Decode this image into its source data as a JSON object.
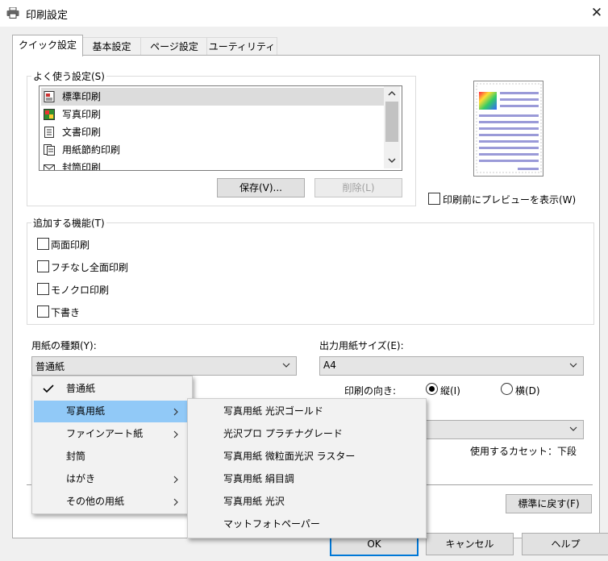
{
  "window": {
    "title": "印刷設定",
    "close_glyph": "✕"
  },
  "tabs": [
    {
      "label": "クイック設定",
      "active": true
    },
    {
      "label": "基本設定",
      "active": false
    },
    {
      "label": "ページ設定",
      "active": false
    },
    {
      "label": "ユーティリティ",
      "active": false
    }
  ],
  "frequent": {
    "legend": "よく使う設定(S)",
    "items": [
      {
        "label": "標準印刷",
        "icon": "standard-print-icon",
        "selected": true
      },
      {
        "label": "写真印刷",
        "icon": "photo-print-icon",
        "selected": false
      },
      {
        "label": "文書印刷",
        "icon": "document-print-icon",
        "selected": false
      },
      {
        "label": "用紙節約印刷",
        "icon": "paper-saving-print-icon",
        "selected": false
      },
      {
        "label": "封筒印刷",
        "icon": "envelope-print-icon",
        "selected": false
      }
    ],
    "save_label": "保存(V)...",
    "delete_label": "削除(L)"
  },
  "preview_checkbox_label": "印刷前にプレビューを表示(W)",
  "features": {
    "legend": "追加する機能(T)",
    "options": [
      {
        "label": "両面印刷",
        "checked": false
      },
      {
        "label": "フチなし全面印刷",
        "checked": false
      },
      {
        "label": "モノクロ印刷",
        "checked": false
      },
      {
        "label": "下書き",
        "checked": false
      }
    ]
  },
  "media_type": {
    "label": "用紙の種類(Y):",
    "value": "普通紙"
  },
  "output_size": {
    "label": "出力用紙サイズ(E):",
    "value": "A4"
  },
  "orientation": {
    "label": "印刷の向き:",
    "portrait": "縦(I)",
    "landscape": "横(D)",
    "selected": "portrait"
  },
  "cassette_text": "使用するカセット：下段",
  "defaults_label": "標準に戻す(F)",
  "footer": {
    "ok": "OK",
    "cancel": "キャンセル",
    "help": "ヘルプ"
  },
  "media_menu": {
    "items": [
      {
        "label": "普通紙",
        "checked": true,
        "submenu": false,
        "highlight": false
      },
      {
        "label": "写真用紙",
        "checked": false,
        "submenu": true,
        "highlight": true
      },
      {
        "label": "ファインアート紙",
        "checked": false,
        "submenu": true,
        "highlight": false
      },
      {
        "label": "封筒",
        "checked": false,
        "submenu": false,
        "highlight": false
      },
      {
        "label": "はがき",
        "checked": false,
        "submenu": true,
        "highlight": false
      },
      {
        "label": "その他の用紙",
        "checked": false,
        "submenu": true,
        "highlight": false
      }
    ]
  },
  "photo_submenu": {
    "items": [
      "写真用紙 光沢ゴールド",
      "光沢プロ プラチナグレード",
      "写真用紙 微粒面光沢 ラスター",
      "写真用紙 絹目調",
      "写真用紙 光沢",
      "マットフォトペーパー"
    ]
  },
  "colors": {
    "highlight": "#91c9f7",
    "menu_bg": "#f2f2f2",
    "panel_border": "#adadad"
  }
}
